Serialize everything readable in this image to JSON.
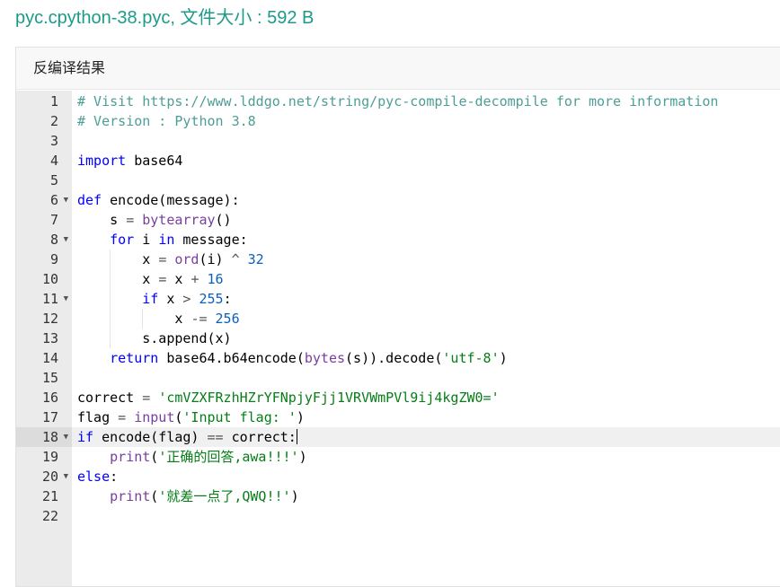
{
  "page": {
    "title": "pyc.cpython-38.pyc, 文件大小 : 592 B"
  },
  "panel": {
    "header": "反编译结果"
  },
  "editor": {
    "active_line": 18,
    "lines": [
      {
        "n": "1",
        "fold": false,
        "text": "# Visit https://www.lddgo.net/string/pyc-compile-decompile for more information"
      },
      {
        "n": "2",
        "fold": false,
        "text": "# Version : Python 3.8"
      },
      {
        "n": "3",
        "fold": false,
        "text": ""
      },
      {
        "n": "4",
        "fold": false,
        "text": "import base64"
      },
      {
        "n": "5",
        "fold": false,
        "text": ""
      },
      {
        "n": "6",
        "fold": true,
        "text": "def encode(message):"
      },
      {
        "n": "7",
        "fold": false,
        "text": "    s = bytearray()"
      },
      {
        "n": "8",
        "fold": true,
        "text": "    for i in message:"
      },
      {
        "n": "9",
        "fold": false,
        "text": "        x = ord(i) ^ 32"
      },
      {
        "n": "10",
        "fold": false,
        "text": "        x = x + 16"
      },
      {
        "n": "11",
        "fold": true,
        "text": "        if x > 255:"
      },
      {
        "n": "12",
        "fold": false,
        "text": "            x -= 256"
      },
      {
        "n": "13",
        "fold": false,
        "text": "        s.append(x)"
      },
      {
        "n": "14",
        "fold": false,
        "text": "    return base64.b64encode(bytes(s)).decode('utf-8')"
      },
      {
        "n": "15",
        "fold": false,
        "text": ""
      },
      {
        "n": "16",
        "fold": false,
        "text": "correct = 'cmVZXFRzhHZrYFNpjyFjj1VRVWmPVl9ij4kgZW0='"
      },
      {
        "n": "17",
        "fold": false,
        "text": "flag = input('Input flag: ')"
      },
      {
        "n": "18",
        "fold": true,
        "text": "if encode(flag) == correct:"
      },
      {
        "n": "19",
        "fold": false,
        "text": "    print('正确的回答,awa!!!')"
      },
      {
        "n": "20",
        "fold": true,
        "text": "else:"
      },
      {
        "n": "21",
        "fold": false,
        "text": "    print('就差一点了,QWQ!!')"
      },
      {
        "n": "22",
        "fold": false,
        "text": ""
      }
    ]
  }
}
